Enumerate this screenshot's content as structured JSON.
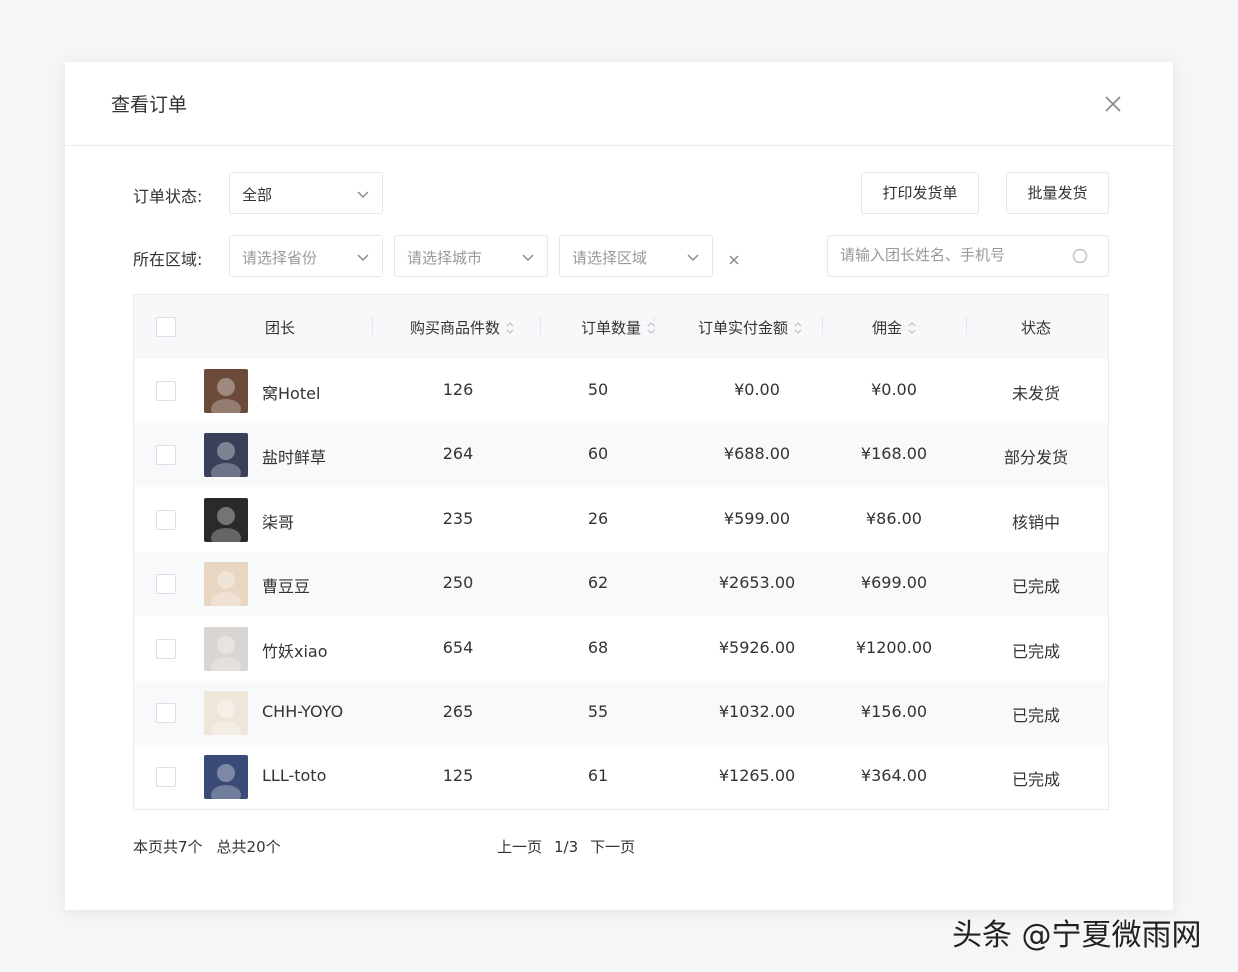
{
  "modal": {
    "title": "查看订单"
  },
  "filters": {
    "status_label": "订单状态:",
    "status_value": "全部",
    "region_label": "所在区域:",
    "province_placeholder": "请选择省份",
    "city_placeholder": "请选择城市",
    "district_placeholder": "请选择区域",
    "search_placeholder": "请输入团长姓名、手机号"
  },
  "actions": {
    "print_label": "打印发货单",
    "batch_label": "批量发货"
  },
  "table": {
    "headers": {
      "leader": "团长",
      "items": "购买商品件数",
      "orders": "订单数量",
      "amount": "订单实付金额",
      "commission": "佣金",
      "status": "状态"
    },
    "rows": [
      {
        "name": "窝Hotel",
        "items": "126",
        "orders": "50",
        "amount": "¥0.00",
        "commission": "¥0.00",
        "status": "未发货",
        "avatar_color": "#6b4a3a"
      },
      {
        "name": "盐时鲜草",
        "items": "264",
        "orders": "60",
        "amount": "¥688.00",
        "commission": "¥168.00",
        "status": "部分发货",
        "avatar_color": "#3a3f5a"
      },
      {
        "name": "柒哥",
        "items": "235",
        "orders": "26",
        "amount": "¥599.00",
        "commission": "¥86.00",
        "status": "核销中",
        "avatar_color": "#2a2a2a"
      },
      {
        "name": "曹豆豆",
        "items": "250",
        "orders": "62",
        "amount": "¥2653.00",
        "commission": "¥699.00",
        "status": "已完成",
        "avatar_color": "#e8d6c2"
      },
      {
        "name": "竹妖xiao",
        "items": "654",
        "orders": "68",
        "amount": "¥5926.00",
        "commission": "¥1200.00",
        "status": "已完成",
        "avatar_color": "#d9d5d2"
      },
      {
        "name": "CHH-YOYO",
        "items": "265",
        "orders": "55",
        "amount": "¥1032.00",
        "commission": "¥156.00",
        "status": "已完成",
        "avatar_color": "#efe6da"
      },
      {
        "name": "LLL-toto",
        "items": "125",
        "orders": "61",
        "amount": "¥1265.00",
        "commission": "¥364.00",
        "status": "已完成",
        "avatar_color": "#3b4b78"
      }
    ]
  },
  "footer": {
    "page_count": "本页共7个",
    "total_count": "总共20个",
    "prev": "上一页",
    "page_indicator": "1/3",
    "next": "下一页"
  },
  "watermark": "头条 @宁夏微雨网"
}
